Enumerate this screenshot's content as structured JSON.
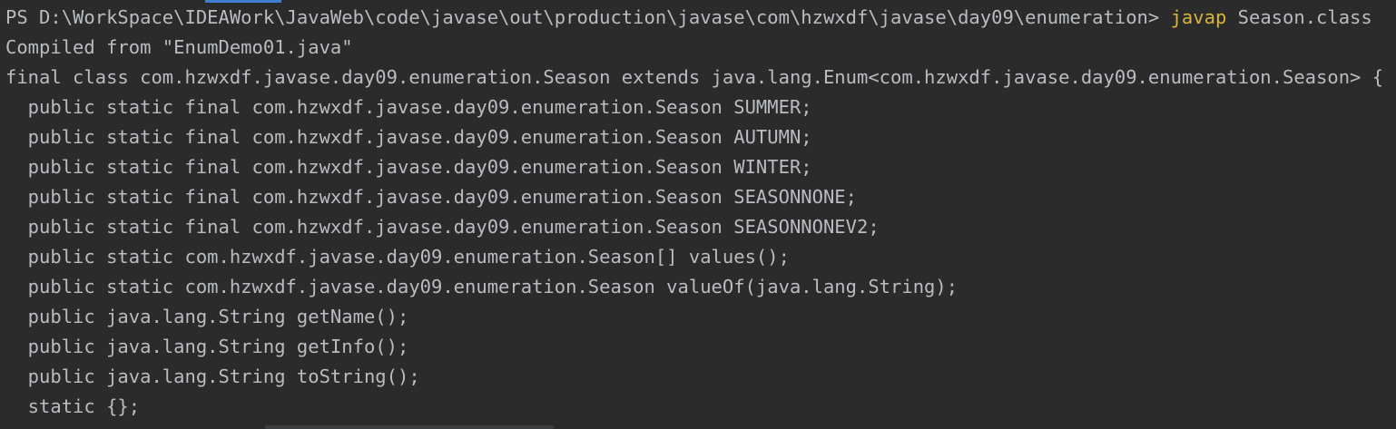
{
  "terminal": {
    "prompt": "PS D:\\WorkSpace\\IDEAWork\\JavaWeb\\code\\javase\\out\\production\\javase\\com\\hzwxdf\\javase\\day09\\enumeration> ",
    "command": "javap",
    "command_args": " Season.class",
    "command_color": "#d9b43c",
    "text_color": "#b9bcc1",
    "background_color": "#2b2b2b",
    "output_lines": [
      "Compiled from \"EnumDemo01.java\"",
      "final class com.hzwxdf.javase.day09.enumeration.Season extends java.lang.Enum<com.hzwxdf.javase.day09.enumeration.Season> {",
      "  public static final com.hzwxdf.javase.day09.enumeration.Season SUMMER;",
      "  public static final com.hzwxdf.javase.day09.enumeration.Season AUTUMN;",
      "  public static final com.hzwxdf.javase.day09.enumeration.Season WINTER;",
      "  public static final com.hzwxdf.javase.day09.enumeration.Season SEASONNONE;",
      "  public static final com.hzwxdf.javase.day09.enumeration.Season SEASONNONEV2;",
      "  public static com.hzwxdf.javase.day09.enumeration.Season[] values();",
      "  public static com.hzwxdf.javase.day09.enumeration.Season valueOf(java.lang.String);",
      "  public java.lang.String getName();",
      "  public java.lang.String getInfo();",
      "  public java.lang.String toString();",
      "  static {};"
    ]
  }
}
